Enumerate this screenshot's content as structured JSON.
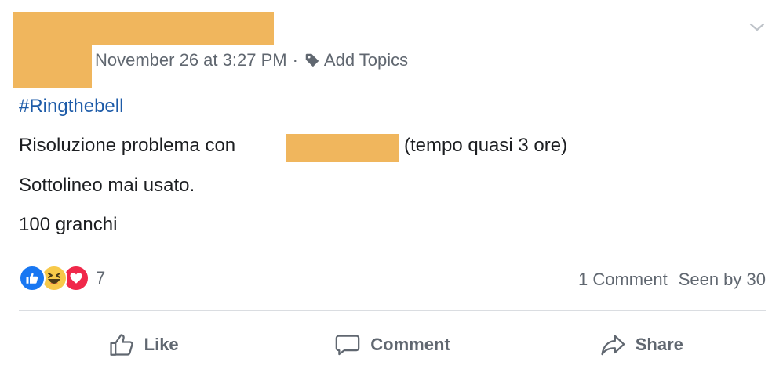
{
  "post": {
    "timestamp": "November 26 at 3:27 PM",
    "separator": "·",
    "add_topics_label": "Add Topics",
    "hashtag": "#Ringthebell",
    "line1_text": "Risoluzione problema con",
    "line1_suffix": "(tempo quasi 3 ore)",
    "line2": "Sottolineo mai usato.",
    "line3": "100 granchi"
  },
  "reactions": {
    "icons": [
      "thumbs-up-icon",
      "laughing-face-icon",
      "heart-icon"
    ],
    "count": "7"
  },
  "stats": {
    "comments": "1 Comment",
    "seen": "Seen by 30"
  },
  "actions": {
    "like": "Like",
    "comment": "Comment",
    "share": "Share"
  },
  "colors": {
    "redaction": "#f0b65d",
    "hashtag": "#1d5ba8",
    "like_blue": "#1877f2",
    "love_red": "#f0284a",
    "haha_yellow": "#f7c94a",
    "muted_text": "#606770"
  }
}
